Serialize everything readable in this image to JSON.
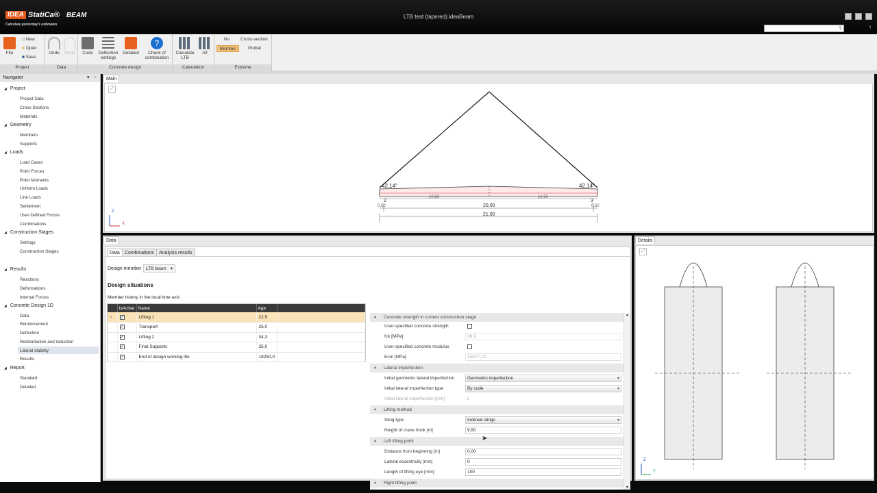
{
  "app": {
    "brand_box": "IDEA",
    "brand_name": "StatiCa®",
    "product": "BEAM",
    "slogan": "Calculate yesterday's estimates",
    "window_title": "LTB test (tapered).ideaBeam"
  },
  "ribbon": {
    "file": "File",
    "new": "New",
    "open": "Open",
    "save": "Save",
    "undo": "Undo",
    "redo": "Redo",
    "code": "Code",
    "deflection": "Deflection",
    "deflection2": "settings",
    "detailed": "Detailed",
    "check1": "Check of",
    "check2": "combination",
    "calc1": "Calculate",
    "calc2": "LTB",
    "all": "All",
    "no": "No",
    "member": "Member",
    "cross_section": "Cross-section",
    "global": "Global",
    "groups": {
      "project": "Project",
      "data": "Data",
      "concrete_design": "Concrete design",
      "calculation": "Calculation",
      "extreme": "Extreme"
    },
    "colors": {
      "file": "#e8621f",
      "detailed": "#e8621f",
      "help": "#1c6fcf",
      "selected": "#f3c27a"
    }
  },
  "navigator": {
    "title": "Navigator",
    "project": "Project",
    "project_data": "Project Data",
    "cross_sections": "Cross-Sections",
    "materials": "Materials",
    "geometry": "Geometry",
    "members": "Members",
    "supports": "Supports",
    "loads": "Loads",
    "load_cases": "Load Cases",
    "point_forces": "Point Forces",
    "point_moments": "Point Moments",
    "uniform_loads": "Uniform Loads",
    "line_loads": "Line Loads",
    "settlement": "Settlement",
    "user_defined_forces": "User-Defined Forces",
    "combinations": "Combinations",
    "construction_stages": "Construction Stages",
    "settings": "Settings",
    "construction_stages_item": "Construction Stages",
    "results": "Results",
    "reactions": "Reactions",
    "deformations": "Deformations",
    "internal_forces": "Internal Forces",
    "concrete_design_1d": "Concrete Design 1D",
    "data": "Data",
    "reinforcement": "Reinforcement",
    "deflection": "Deflection",
    "redistribution": "Redistribution and reduction",
    "lateral_stability": "Lateral stability",
    "results_item": "Results",
    "report": "Report",
    "standard": "Standard",
    "detailed": "Detailed"
  },
  "main": {
    "tab": "Main",
    "angle_left": "42.14°",
    "angle_right": "42.14°",
    "node_left": "2",
    "node_right": "3",
    "dim_half_left": "10,50",
    "dim_half_right": "10,50",
    "dim_end_left": "0,50",
    "dim_end_right": "0,50",
    "dim_span": "20,00",
    "dim_total": "21,00",
    "axis_z": "Z",
    "axis_x": "X"
  },
  "data_panel": {
    "title": "Data",
    "tabs": [
      "Data",
      "Combinations",
      "Analysis results"
    ],
    "design_member_label": "Design member",
    "design_member_value": "LTB beam",
    "design_situations": "Design situations",
    "history_label": "Member history in the local time axis",
    "columns": [
      "IsActive",
      "Name",
      "Age"
    ],
    "rows": [
      {
        "name": "Lifting 1",
        "age": "22,5"
      },
      {
        "name": "Transport",
        "age": "25,0"
      },
      {
        "name": "Lifting 2",
        "age": "34,3"
      },
      {
        "name": "Final Supports",
        "age": "35,0"
      },
      {
        "name": "End of design working life",
        "age": "18250,0"
      }
    ],
    "props": {
      "sec_concrete": "Concrete strength in current construction stage",
      "user_strength": "User-specified concrete strength",
      "fck_label": "fck [MPa]",
      "fck_value": "38,9",
      "user_modulus": "User-specified concrete modulus",
      "ecm_label": "Ecm [MPa]",
      "ecm_value": "34977,13",
      "sec_lateral": "Lateral imperfection",
      "init_geom_label": "Initial geometric lateral imperfection",
      "init_geom_value": "Geometric imperfection",
      "init_type_label": "Initial lateral imperfection type",
      "init_type_value": "By code",
      "init_mm_label": "Initial lateral imperfection [mm]",
      "init_mm_value": "0",
      "sec_lifting": "Lifting method",
      "sling_label": "Sling type",
      "sling_value": "Inclined slings",
      "hook_label": "Height of crane hook [m]",
      "hook_value": "9,50",
      "sec_left": "Left lifting point",
      "dist_label": "Distance from beginning [m]",
      "dist_value": "0,00",
      "ecc_label": "Lateral eccentricity [mm]",
      "ecc_value": "0",
      "eye_label": "Length of lifting eye [mm]",
      "eye_value": "100",
      "sec_right": "Right lifting point"
    }
  },
  "details": {
    "title": "Details",
    "axis_z": "Z",
    "axis_y": "Y"
  }
}
